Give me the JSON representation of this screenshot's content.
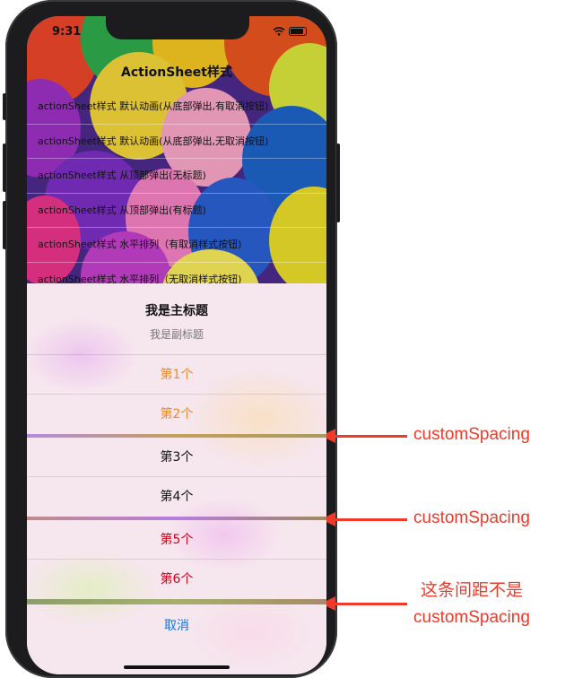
{
  "status_bar": {
    "time": "9:31"
  },
  "nav": {
    "title": "ActionSheet样式"
  },
  "list": {
    "rows": [
      "actionSheet样式 默认动画(从底部弹出,有取消按钮)",
      "actionSheet样式 默认动画(从底部弹出,无取消按钮)",
      "actionSheet样式 从顶部弹出(无标题)",
      "actionSheet样式 从顶部弹出(有标题)",
      "actionSheet样式 水平排列（有取消样式按钮)",
      "actionSheet样式 水平排列（无取消样式按钮)"
    ]
  },
  "sheet": {
    "title": "我是主标题",
    "subtitle": "我是副标题",
    "buttons": [
      {
        "label": "第1个",
        "color": "#ee8a2c"
      },
      {
        "label": "第2个",
        "color": "#ee8a2c"
      },
      {
        "label": "第3个",
        "color": "#111111"
      },
      {
        "label": "第4个",
        "color": "#111111"
      },
      {
        "label": "第5个",
        "color": "#d0021b"
      },
      {
        "label": "第6个",
        "color": "#d0021b"
      }
    ],
    "cancel": {
      "label": "取消",
      "color": "#1a73d9"
    }
  },
  "annotations": {
    "spacing_1": "customSpacing",
    "spacing_2": "customSpacing",
    "note_line1": "这条间距不是",
    "note_line2": "customSpacing",
    "color": "#ef3a2a"
  }
}
